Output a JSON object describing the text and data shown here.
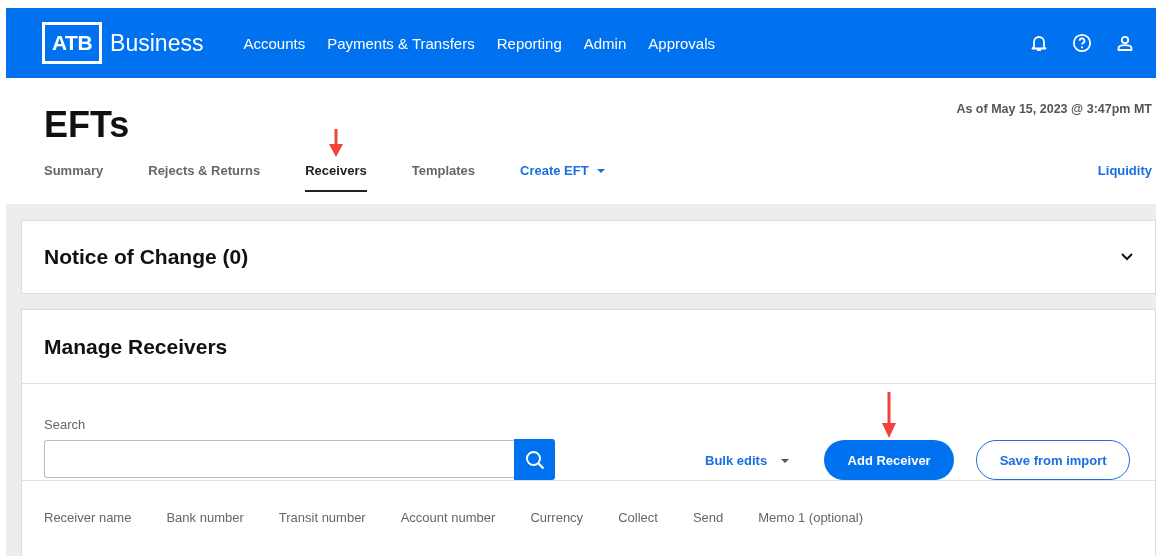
{
  "header": {
    "logo_mark": "ATB",
    "logo_name": "Business",
    "nav": [
      "Accounts",
      "Payments & Transfers",
      "Reporting",
      "Admin",
      "Approvals"
    ]
  },
  "page": {
    "title": "EFTs",
    "timestamp": "As of May 15, 2023 @ 3:47pm MT",
    "tabs": [
      {
        "label": "Summary",
        "selected": false,
        "annotated": false
      },
      {
        "label": "Rejects & Returns",
        "selected": false,
        "annotated": false
      },
      {
        "label": "Receivers",
        "selected": true,
        "annotated": true
      },
      {
        "label": "Templates",
        "selected": false,
        "annotated": false
      }
    ],
    "create_menu": "Create EFT",
    "liquidity_link": "Liquidity"
  },
  "notice": {
    "title": "Notice of Change (0)",
    "expanded": false
  },
  "receivers": {
    "title": "Manage Receivers",
    "search": {
      "label": "Search"
    },
    "bulk_menu": "Bulk edits",
    "buttons": [
      {
        "label": "Add Receiver",
        "kind": "primary",
        "annotated": true
      },
      {
        "label": "Save from import",
        "kind": "secondary",
        "annotated": false
      }
    ],
    "columns": [
      "Receiver name",
      "Bank number",
      "Transit number",
      "Account number",
      "Currency",
      "Collect",
      "Send",
      "Memo 1 (optional)"
    ]
  }
}
